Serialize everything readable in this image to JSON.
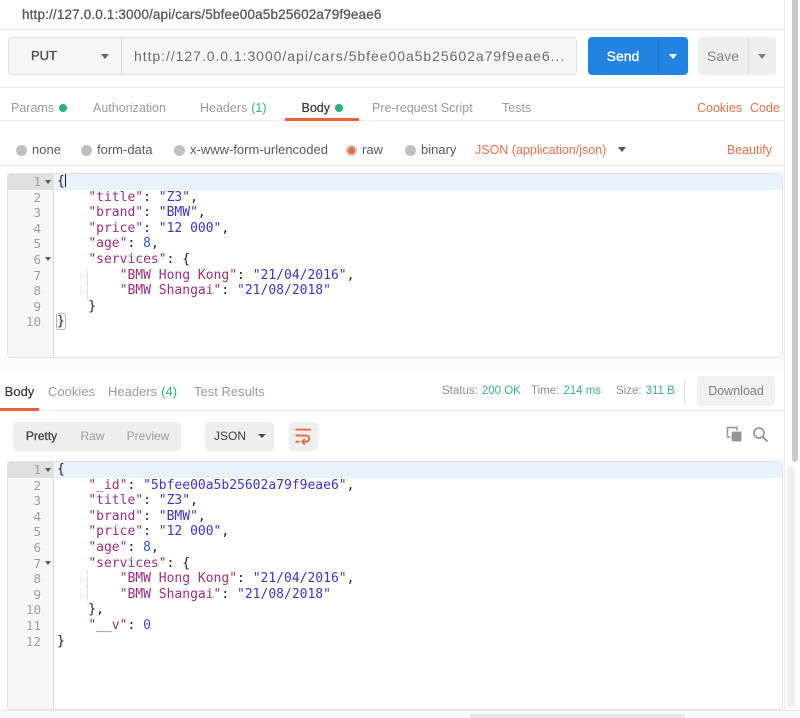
{
  "titlebar": {
    "title": "http://127.0.0.1:3000/api/cars/5bfee00a5b25602a79f9eae6"
  },
  "request": {
    "method": "PUT",
    "url": "http://127.0.0.1:3000/api/cars/5bfee00a5b25602a79f9eae6...",
    "send_label": "Send",
    "save_label": "Save"
  },
  "request_tabs": {
    "params": "Params",
    "authorization": "Authorization",
    "headers": "Headers",
    "headers_badge": "(1)",
    "body": "Body",
    "prerequest": "Pre-request Script",
    "tests": "Tests",
    "cookies": "Cookies",
    "code": "Code"
  },
  "body_type": {
    "none": "none",
    "form_data": "form-data",
    "x_www": "x-www-form-urlencoded",
    "raw": "raw",
    "binary": "binary",
    "selected": "raw",
    "content_type": "JSON (application/json)",
    "beautify": "Beautify"
  },
  "colors": {
    "accent_orange": "#f0613a",
    "green": "#28b77b",
    "send_blue": "#2184e2",
    "json_key": "#a02c85",
    "json_string": "#3a31e0",
    "json_number": "#2f55cf"
  },
  "editors": {
    "request": {
      "lines": [
        {
          "n": 1,
          "fold": true,
          "active": true,
          "cursor": true,
          "tokens": [
            [
              "p",
              "{"
            ]
          ]
        },
        {
          "n": 2,
          "tokens": [
            [
              "p",
              "    "
            ],
            [
              "k",
              "\"title\""
            ],
            [
              "p",
              ": "
            ],
            [
              "s",
              "\"Z3\""
            ],
            [
              "p",
              ","
            ]
          ]
        },
        {
          "n": 3,
          "tokens": [
            [
              "p",
              "    "
            ],
            [
              "k",
              "\"brand\""
            ],
            [
              "p",
              ": "
            ],
            [
              "s",
              "\"BMW\""
            ],
            [
              "p",
              ","
            ]
          ]
        },
        {
          "n": 4,
          "tokens": [
            [
              "p",
              "    "
            ],
            [
              "k",
              "\"price\""
            ],
            [
              "p",
              ": "
            ],
            [
              "s",
              "\"12 000\""
            ],
            [
              "p",
              ","
            ]
          ]
        },
        {
          "n": 5,
          "tokens": [
            [
              "p",
              "    "
            ],
            [
              "k",
              "\"age\""
            ],
            [
              "p",
              ": "
            ],
            [
              "n2",
              "8"
            ],
            [
              "p",
              ","
            ]
          ]
        },
        {
          "n": 6,
          "fold": true,
          "tokens": [
            [
              "p",
              "    "
            ],
            [
              "k",
              "\"services\""
            ],
            [
              "p",
              ": {"
            ]
          ]
        },
        {
          "n": 7,
          "guide": true,
          "tokens": [
            [
              "p",
              "        "
            ],
            [
              "k",
              "\"BMW Hong Kong\""
            ],
            [
              "p",
              ": "
            ],
            [
              "s",
              "\"21/04/2016\""
            ],
            [
              "p",
              ","
            ]
          ]
        },
        {
          "n": 8,
          "guide": true,
          "tokens": [
            [
              "p",
              "        "
            ],
            [
              "k",
              "\"BMW Shangai\""
            ],
            [
              "p",
              ": "
            ],
            [
              "s",
              "\"21/08/2018\""
            ]
          ]
        },
        {
          "n": 9,
          "tokens": [
            [
              "p",
              "    }"
            ]
          ]
        },
        {
          "n": 10,
          "tokens": [
            [
              "m",
              "}"
            ]
          ]
        }
      ]
    },
    "response": {
      "lines": [
        {
          "n": 1,
          "fold": true,
          "active": true,
          "tokens": [
            [
              "p",
              "{"
            ]
          ]
        },
        {
          "n": 2,
          "tokens": [
            [
              "p",
              "    "
            ],
            [
              "k",
              "\"_id\""
            ],
            [
              "p",
              ": "
            ],
            [
              "s",
              "\"5bfee00a5b25602a79f9eae6\""
            ],
            [
              "p",
              ","
            ]
          ]
        },
        {
          "n": 3,
          "tokens": [
            [
              "p",
              "    "
            ],
            [
              "k",
              "\"title\""
            ],
            [
              "p",
              ": "
            ],
            [
              "s",
              "\"Z3\""
            ],
            [
              "p",
              ","
            ]
          ]
        },
        {
          "n": 4,
          "tokens": [
            [
              "p",
              "    "
            ],
            [
              "k",
              "\"brand\""
            ],
            [
              "p",
              ": "
            ],
            [
              "s",
              "\"BMW\""
            ],
            [
              "p",
              ","
            ]
          ]
        },
        {
          "n": 5,
          "tokens": [
            [
              "p",
              "    "
            ],
            [
              "k",
              "\"price\""
            ],
            [
              "p",
              ": "
            ],
            [
              "s",
              "\"12 000\""
            ],
            [
              "p",
              ","
            ]
          ]
        },
        {
          "n": 6,
          "tokens": [
            [
              "p",
              "    "
            ],
            [
              "k",
              "\"age\""
            ],
            [
              "p",
              ": "
            ],
            [
              "n2",
              "8"
            ],
            [
              "p",
              ","
            ]
          ]
        },
        {
          "n": 7,
          "fold": true,
          "tokens": [
            [
              "p",
              "    "
            ],
            [
              "k",
              "\"services\""
            ],
            [
              "p",
              ": {"
            ]
          ]
        },
        {
          "n": 8,
          "guide": true,
          "tokens": [
            [
              "p",
              "        "
            ],
            [
              "k",
              "\"BMW Hong Kong\""
            ],
            [
              "p",
              ": "
            ],
            [
              "s",
              "\"21/04/2016\""
            ],
            [
              "p",
              ","
            ]
          ]
        },
        {
          "n": 9,
          "guide": true,
          "tokens": [
            [
              "p",
              "        "
            ],
            [
              "k",
              "\"BMW Shangai\""
            ],
            [
              "p",
              ": "
            ],
            [
              "s",
              "\"21/08/2018\""
            ]
          ]
        },
        {
          "n": 10,
          "tokens": [
            [
              "p",
              "    },"
            ]
          ]
        },
        {
          "n": 11,
          "tokens": [
            [
              "p",
              "    "
            ],
            [
              "k",
              "\"__v\""
            ],
            [
              "p",
              ": "
            ],
            [
              "n2",
              "0"
            ]
          ]
        },
        {
          "n": 12,
          "tokens": [
            [
              "p",
              "}"
            ]
          ]
        }
      ]
    }
  },
  "response_meta": {
    "tab_body": "Body",
    "tab_cookies": "Cookies",
    "tab_headers": "Headers",
    "headers_badge": "(4)",
    "tab_tests": "Test Results",
    "status_label": "Status:",
    "status_value": "200 OK",
    "time_label": "Time:",
    "time_value": "214 ms",
    "size_label": "Size:",
    "size_value": "311 B",
    "download": "Download"
  },
  "response_toolbar": {
    "pretty": "Pretty",
    "raw": "Raw",
    "preview": "Preview",
    "active_view": "Pretty",
    "format": "JSON"
  }
}
